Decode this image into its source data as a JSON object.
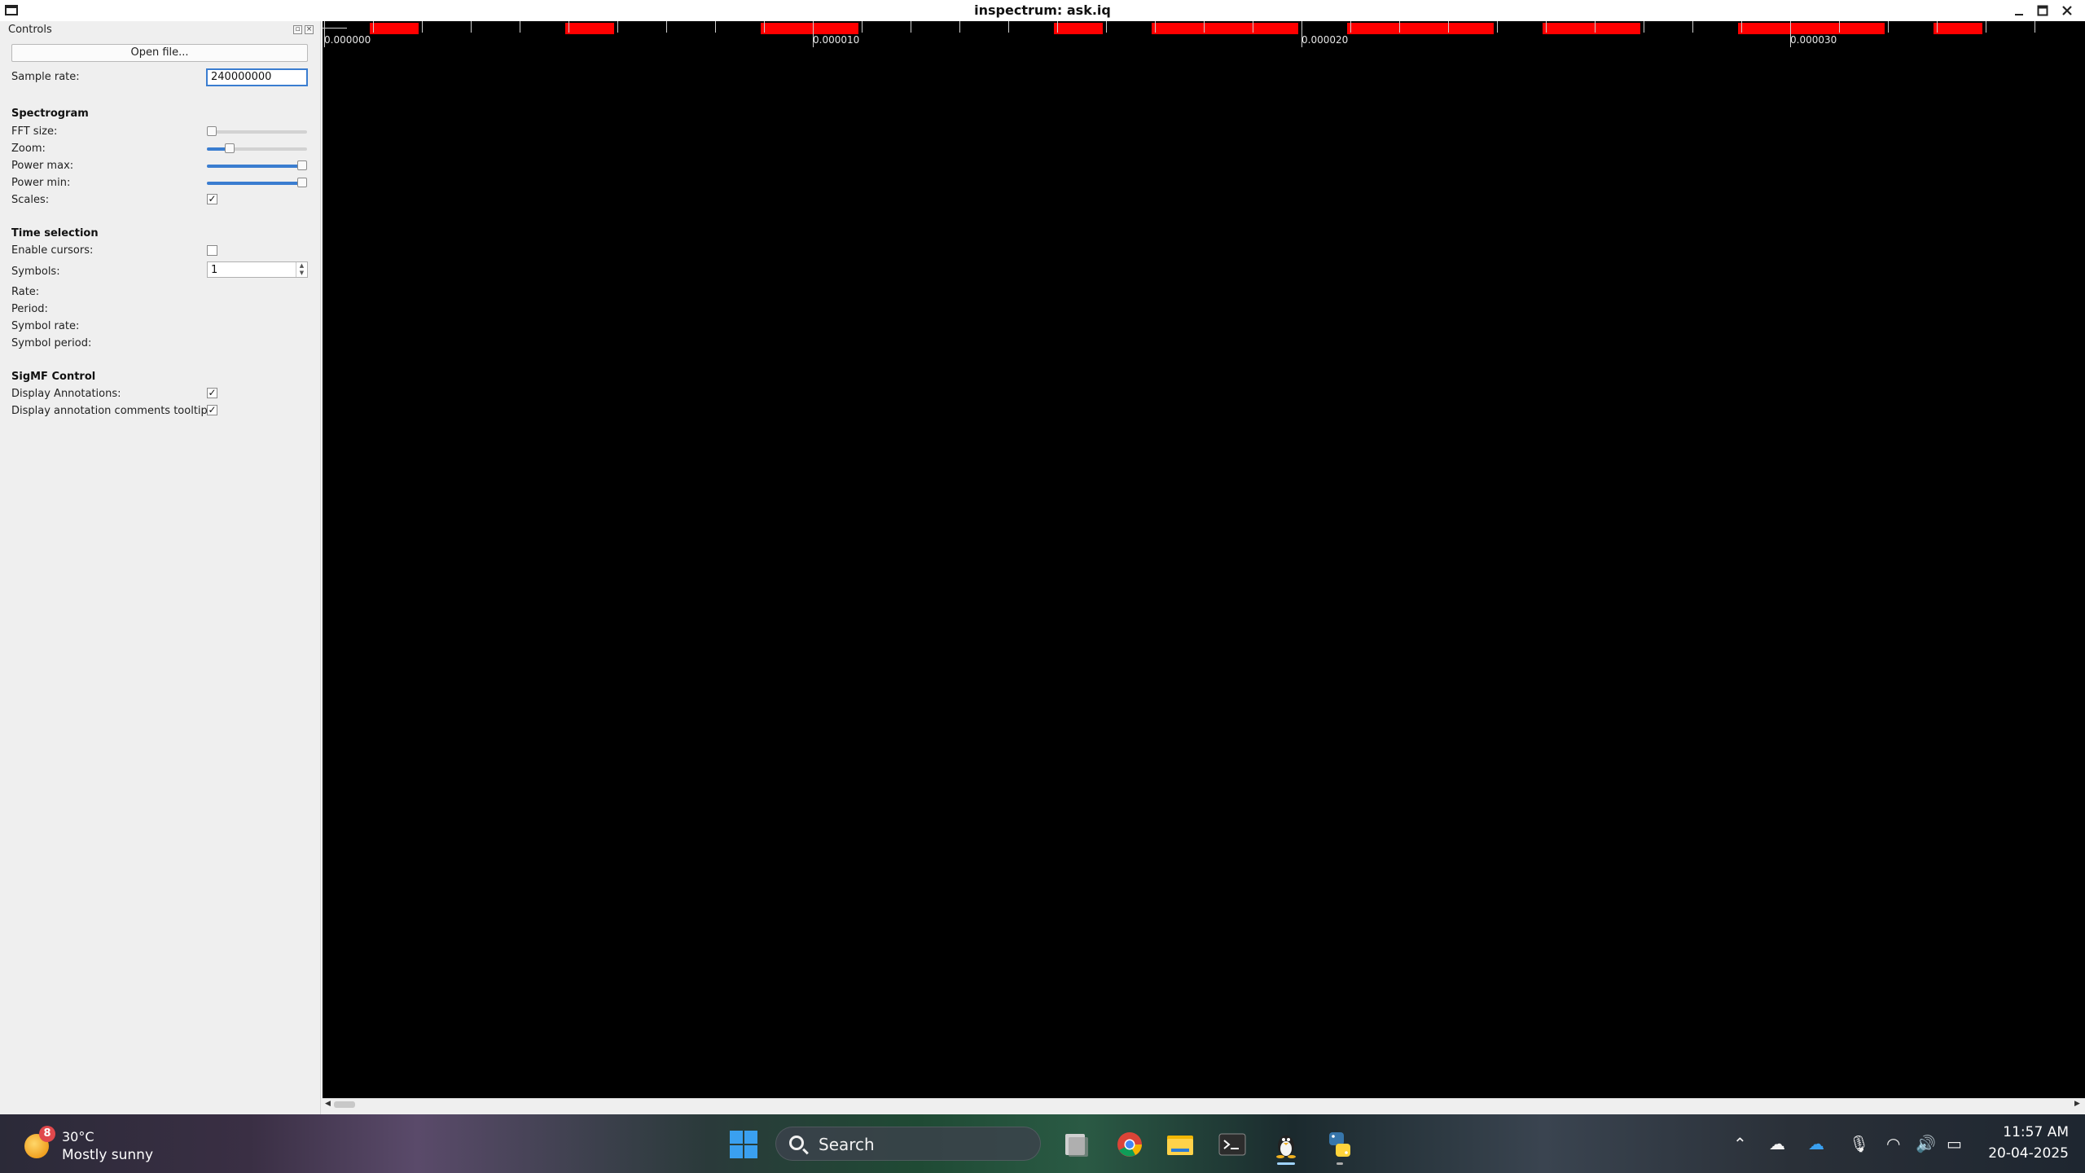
{
  "window": {
    "title": "inspectrum: ask.iq"
  },
  "dock": {
    "title": "Controls",
    "open_file_label": "Open file...",
    "sample_rate_label": "Sample rate:",
    "sample_rate_value": "240000000",
    "spectrogram": {
      "heading": "Spectrogram",
      "fft_size_label": "FFT size:",
      "fft_size_level": 0.0,
      "zoom_label": "Zoom:",
      "zoom_level": 0.2,
      "power_max_label": "Power max:",
      "power_max_level": 1.0,
      "power_min_label": "Power min:",
      "power_min_level": 1.0,
      "scales_label": "Scales:",
      "scales_checked": true
    },
    "time_selection": {
      "heading": "Time selection",
      "enable_cursors_label": "Enable cursors:",
      "enable_cursors_checked": false,
      "symbols_label": "Symbols:",
      "symbols_value": "1",
      "rate_label": "Rate:",
      "period_label": "Period:",
      "symbol_rate_label": "Symbol rate:",
      "symbol_period_label": "Symbol period:"
    },
    "sigmf": {
      "heading": "SigMF Control",
      "display_annotations_label": "Display Annotations:",
      "display_annotations_checked": true,
      "tooltips_label": "Display annotation comments tooltips:",
      "tooltips_checked": true
    }
  },
  "plot": {
    "time_axis_labels": [
      "0.000000",
      "0.000010",
      "0.000020",
      "0.000030"
    ],
    "annotation_color": "#ff0000",
    "background_color": "#000000"
  },
  "taskbar": {
    "weather_temp": "30°C",
    "weather_condition": "Mostly sunny",
    "weather_badge": "8",
    "search_label": "Search",
    "apps": [
      "windows-start-icon",
      "files-icon",
      "chrome-icon",
      "file-explorer-icon",
      "terminal-icon",
      "linux-tux-icon",
      "python-icon"
    ],
    "clock_time": "11:57 AM",
    "clock_date": "20-04-2025"
  }
}
